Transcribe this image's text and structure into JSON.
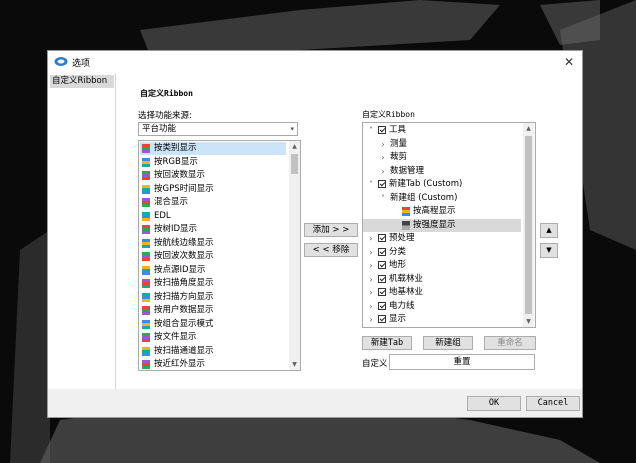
{
  "dialog": {
    "title": "选项",
    "close_glyph": "✕"
  },
  "nav": {
    "items": [
      {
        "label": "自定义Ribbon"
      }
    ]
  },
  "section_title": "自定义Ribbon",
  "source": {
    "label": "选择功能来源:",
    "selected": "平台功能",
    "items": [
      {
        "label": "按类别显示",
        "icon": "category-color-icon",
        "selected": true
      },
      {
        "label": "按RGB显示",
        "icon": "rgb-color-icon"
      },
      {
        "label": "按回波数显示",
        "icon": "echo-count-icon"
      },
      {
        "label": "按GPS时间显示",
        "icon": "gps-time-icon"
      },
      {
        "label": "混合显示",
        "icon": "mixed-display-icon"
      },
      {
        "label": "EDL",
        "icon": "edl-icon"
      },
      {
        "label": "按树ID显示",
        "icon": "tree-id-icon"
      },
      {
        "label": "按航线边缘显示",
        "icon": "flight-edge-icon"
      },
      {
        "label": "按回波次数显示",
        "icon": "echo-number-icon"
      },
      {
        "label": "按点源ID显示",
        "icon": "point-source-icon"
      },
      {
        "label": "按扫描角度显示",
        "icon": "scan-angle-icon"
      },
      {
        "label": "按扫描方向显示",
        "icon": "scan-direction-icon"
      },
      {
        "label": "按用户数据显示",
        "icon": "user-data-icon"
      },
      {
        "label": "按组合显示模式",
        "icon": "combined-mode-icon"
      },
      {
        "label": "按文件显示",
        "icon": "file-display-icon"
      },
      {
        "label": "按扫描通道显示",
        "icon": "scan-channel-icon"
      },
      {
        "label": "按近红外显示",
        "icon": "nir-display-icon"
      }
    ]
  },
  "middle": {
    "add_label": "添加 > >",
    "remove_label": "< < 移除"
  },
  "ribbon": {
    "label": "自定义Ribbon",
    "tree": [
      {
        "label": "工具",
        "level": 0,
        "expander": "v",
        "checkbox": true
      },
      {
        "label": "测量",
        "level": 1,
        "expander": ">"
      },
      {
        "label": "裁剪",
        "level": 1,
        "expander": ">"
      },
      {
        "label": "数据管理",
        "level": 1,
        "expander": ">"
      },
      {
        "label": "新建Tab (Custom)",
        "level": 0,
        "expander": "v",
        "checkbox": true
      },
      {
        "label": "新建组 (Custom)",
        "level": 1,
        "expander": "v"
      },
      {
        "label": "按高程显示",
        "level": 2,
        "icon": "elevation-icon"
      },
      {
        "label": "按强度显示",
        "level": 2,
        "icon": "intensity-icon",
        "selected": true
      },
      {
        "label": "预处理",
        "level": 0,
        "expander": ">",
        "checkbox": true
      },
      {
        "label": "分类",
        "level": 0,
        "expander": ">",
        "checkbox": true
      },
      {
        "label": "地形",
        "level": 0,
        "expander": ">",
        "checkbox": true
      },
      {
        "label": "机载林业",
        "level": 0,
        "expander": ">",
        "checkbox": true
      },
      {
        "label": "地基林业",
        "level": 0,
        "expander": ">",
        "checkbox": true
      },
      {
        "label": "电力线",
        "level": 0,
        "expander": ">",
        "checkbox": true
      },
      {
        "label": "显示",
        "level": 0,
        "expander": ">",
        "checkbox": true
      }
    ],
    "new_tab_label": "新建Tab",
    "new_group_label": "新建组",
    "rename_label": "重命名",
    "custom_label": "自定义",
    "reset_label": "重置",
    "move_up_glyph": "▲",
    "move_down_glyph": "▼"
  },
  "footer": {
    "ok_label": "OK",
    "cancel_label": "Cancel"
  },
  "colors": {
    "accent_selection": "#cce4f7",
    "tree_selection": "#d9d9d9",
    "background": "#0a0a0a"
  }
}
